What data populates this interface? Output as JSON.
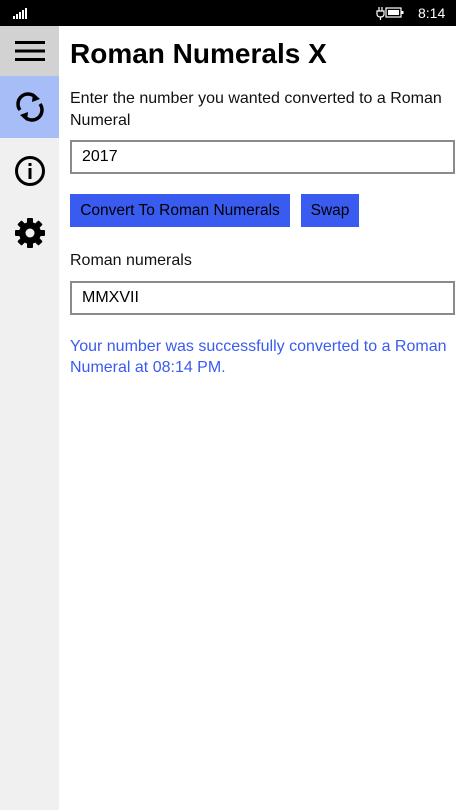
{
  "status_bar": {
    "time": "8:14",
    "icons": [
      "signal-icon",
      "battery-charging-icon"
    ]
  },
  "sidebar": {
    "items": [
      {
        "icon": "hamburger-icon"
      },
      {
        "icon": "refresh-icon",
        "selected": true
      },
      {
        "icon": "info-icon"
      },
      {
        "icon": "gear-icon"
      }
    ],
    "accent_color": "#a7bdf7"
  },
  "main": {
    "title": "Roman Numerals X",
    "prompt": "Enter the number you wanted converted to a Roman Numeral",
    "number_value": "2017",
    "convert_label": "Convert To Roman Numerals",
    "swap_label": "Swap",
    "roman_label": "Roman numerals",
    "roman_value": "MMXVII",
    "status_message": "Your number was successfully converted to a Roman Numeral at 08:14 PM."
  },
  "colors": {
    "button": "#3a5bf0",
    "message": "#3a5bf0"
  }
}
